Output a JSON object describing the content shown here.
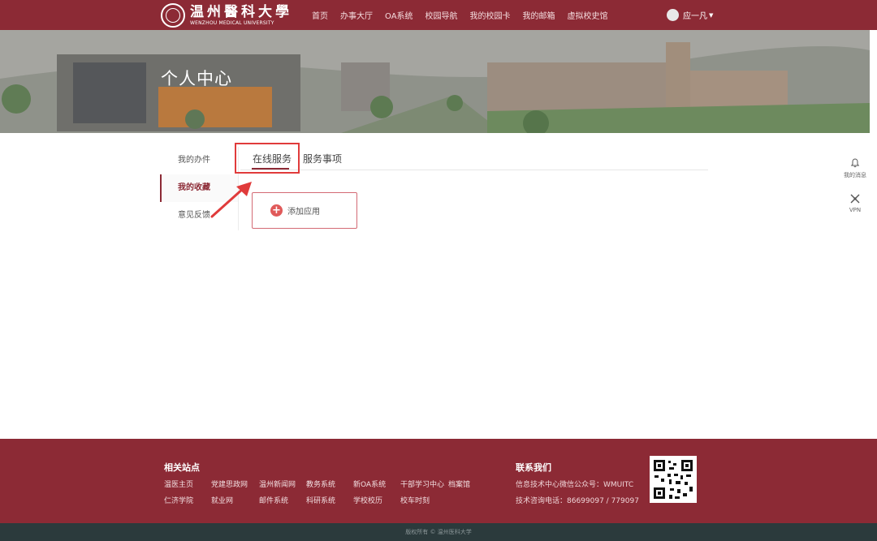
{
  "header": {
    "logo_cn": "温州醫科大學",
    "logo_en": "WENZHOU MEDICAL UNIVERSITY",
    "nav": [
      "首页",
      "办事大厅",
      "OA系统",
      "校园导航",
      "我的校园卡",
      "我的邮箱",
      "虚拟校史馆"
    ],
    "user_name": "应一凡",
    "caret_icon": "caret-down-icon"
  },
  "banner": {
    "title": "个人中心"
  },
  "side_menu": {
    "items": [
      "我的办件",
      "我的收藏",
      "意见反馈"
    ],
    "active_index": 1
  },
  "tabs": {
    "items": [
      "在线服务",
      "服务事项"
    ],
    "active_index": 0
  },
  "add_app": {
    "label": "添加应用",
    "icon": "plus-circle-icon"
  },
  "floating_tools": {
    "notifications_label": "我的消息",
    "vpn_label": "VPN"
  },
  "footer": {
    "sites_title": "相关站点",
    "sites_row1": [
      "温医主页",
      "党建思政网",
      "温州新闻网",
      "教务系统",
      "新OA系统",
      "干部学习中心",
      "档案馆"
    ],
    "sites_row2": [
      "仁济学院",
      "就业网",
      "邮件系统",
      "科研系统",
      "学校校历",
      "校车时刻"
    ],
    "contact_title": "联系我们",
    "contact_lines": [
      "信息技术中心微信公众号：WMUITC",
      "技术咨询电话：86699097 / 779097"
    ],
    "copyright": "版权所有 © 温州医科大学"
  },
  "colors": {
    "brand": "#8c2a35",
    "highlight": "#e03b3b",
    "footer_bottom": "#2b3a3c"
  }
}
